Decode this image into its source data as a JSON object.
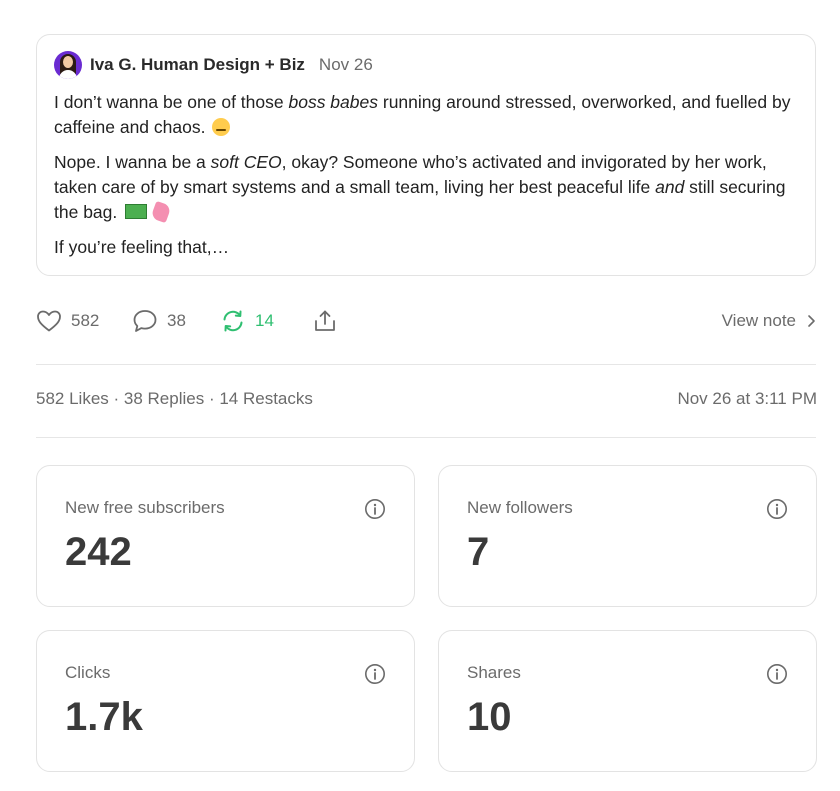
{
  "note": {
    "author": "Iva G. Human Design + Biz",
    "date": "Nov 26",
    "p1": {
      "a": "I don’t wanna be one of those ",
      "b": "boss babes",
      "c": " running around stressed, overworked, and fuelled by caffeine and chaos."
    },
    "p2": {
      "a": "Nope. I wanna be a ",
      "b": "soft CEO",
      "c": ", okay? Someone who’s activated and invigorated by her work, taken care of by smart systems and a small team, living her best peaceful life ",
      "d": "and",
      "e": " still securing the bag."
    },
    "p3": "If you’re feeling that,…"
  },
  "actions": {
    "likes": "582",
    "replies": "38",
    "restacks": "14",
    "view_note": "View note"
  },
  "summary": {
    "likes": "582 Likes",
    "sep1": " · ",
    "replies": "38 Replies",
    "sep2": " · ",
    "restacks": "14 Restacks",
    "timestamp": "Nov 26 at 3:11 PM"
  },
  "stats": [
    {
      "label": "New free subscribers",
      "value": "242"
    },
    {
      "label": "New followers",
      "value": "7"
    },
    {
      "label": "Clicks",
      "value": "1.7k"
    },
    {
      "label": "Shares",
      "value": "10"
    }
  ],
  "colors": {
    "restack_accent": "#2fbf71",
    "avatar_bg": "#6a2bd1"
  }
}
